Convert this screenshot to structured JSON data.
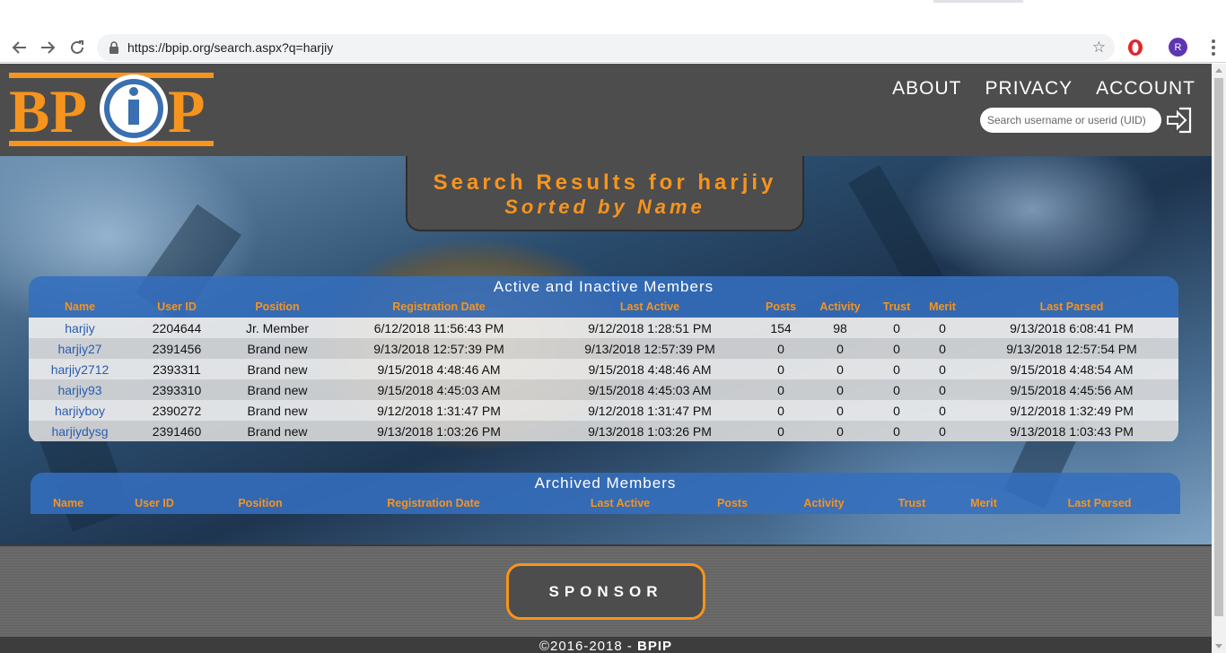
{
  "browser": {
    "url": "https://bpip.org/search.aspx?q=harjiy",
    "profile_initial": "R"
  },
  "header": {
    "logo_text": "BPIP",
    "nav": [
      "ABOUT",
      "PRIVACY",
      "ACCOUNT"
    ],
    "search_placeholder": "Search username or userid (UID)"
  },
  "title": {
    "line1": "Search Results for harjiy",
    "line2": "Sorted by Name"
  },
  "active_table": {
    "heading": "Active and Inactive Members",
    "columns": [
      "Name",
      "User ID",
      "Position",
      "Registration Date",
      "Last Active",
      "Posts",
      "Activity",
      "Trust",
      "Merit",
      "Last Parsed"
    ],
    "rows": [
      [
        "harjiy",
        "2204644",
        "Jr. Member",
        "6/12/2018 11:56:43 PM",
        "9/12/2018 1:28:51 PM",
        "154",
        "98",
        "0",
        "0",
        "9/13/2018 6:08:41 PM"
      ],
      [
        "harjiy27",
        "2391456",
        "Brand new",
        "9/13/2018 12:57:39 PM",
        "9/13/2018 12:57:39 PM",
        "0",
        "0",
        "0",
        "0",
        "9/13/2018 12:57:54 PM"
      ],
      [
        "harjiy2712",
        "2393311",
        "Brand new",
        "9/15/2018 4:48:46 AM",
        "9/15/2018 4:48:46 AM",
        "0",
        "0",
        "0",
        "0",
        "9/15/2018 4:48:54 AM"
      ],
      [
        "harjiy93",
        "2393310",
        "Brand new",
        "9/15/2018 4:45:03 AM",
        "9/15/2018 4:45:03 AM",
        "0",
        "0",
        "0",
        "0",
        "9/15/2018 4:45:56 AM"
      ],
      [
        "harjiyboy",
        "2390272",
        "Brand new",
        "9/12/2018 1:31:47 PM",
        "9/12/2018 1:31:47 PM",
        "0",
        "0",
        "0",
        "0",
        "9/12/2018 1:32:49 PM"
      ],
      [
        "harjiydysg",
        "2391460",
        "Brand new",
        "9/13/2018 1:03:26 PM",
        "9/13/2018 1:03:26 PM",
        "0",
        "0",
        "0",
        "0",
        "9/13/2018 1:03:43 PM"
      ]
    ]
  },
  "archived_table": {
    "heading": "Archived Members",
    "columns": [
      "Name",
      "User ID",
      "Position",
      "Registration Date",
      "Last Active",
      "Posts",
      "Activity",
      "Trust",
      "Merit",
      "Last Parsed"
    ]
  },
  "footer": {
    "sponsor_label": "SPONSOR",
    "copyright": "©2016-2018 - ",
    "brand": "BPIP"
  },
  "colors": {
    "accent": "#f7941d",
    "header_bg": "#4d4d4d",
    "table_header": "#346ebe",
    "link": "#2a5db0"
  }
}
